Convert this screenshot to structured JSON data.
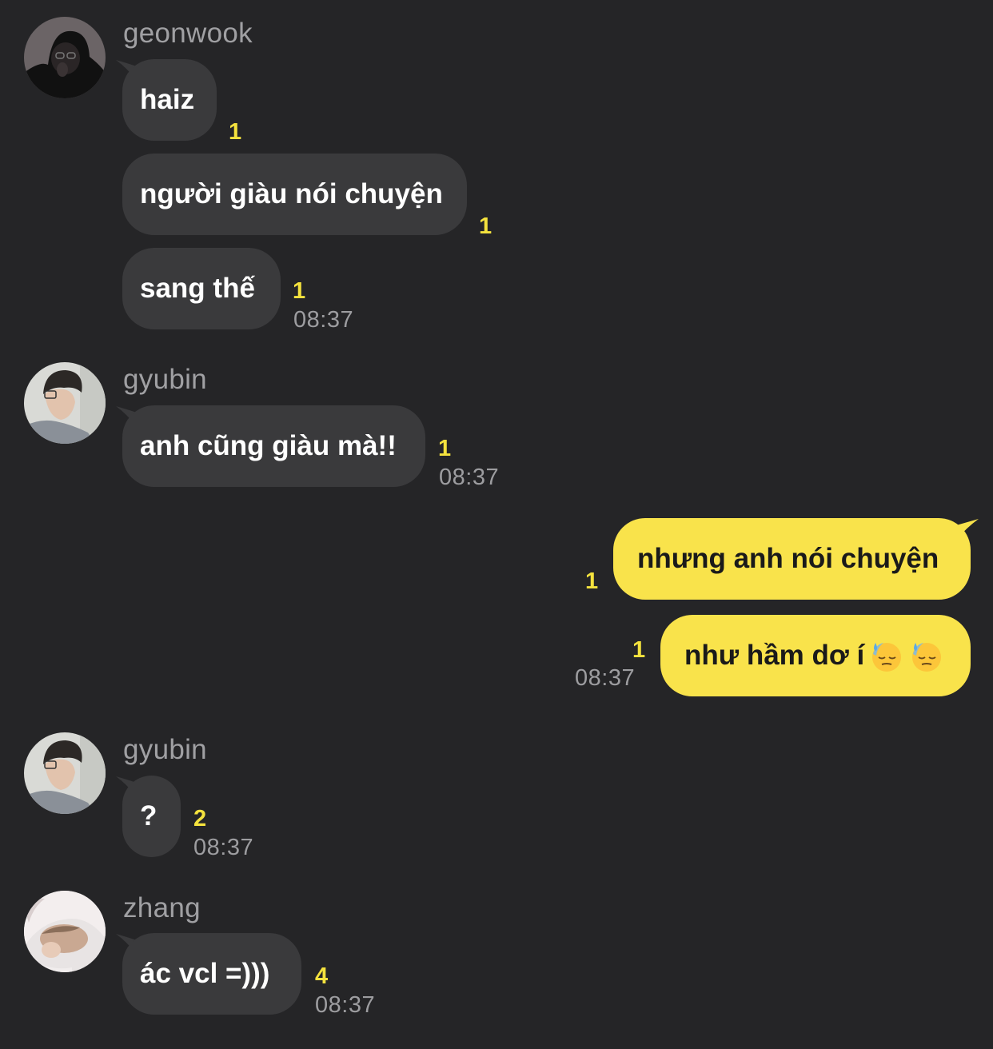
{
  "messages": {
    "g1": {
      "sender": "geonwook",
      "m1": "haiz",
      "m1_count": "1",
      "m2": "người giàu nói chuyện",
      "m2_count": "1",
      "m3": "sang thế",
      "m3_count": "1",
      "time": "08:37"
    },
    "g2": {
      "sender": "gyubin",
      "m1": "anh cũng giàu mà!!",
      "m1_count": "1",
      "time": "08:37"
    },
    "g3": {
      "m1": "nhưng anh nói chuyện",
      "m1_count": "1",
      "m2": "như hầm dơ í",
      "m2_count": "1",
      "time": "08:37"
    },
    "g4": {
      "sender": "gyubin",
      "m1": "?",
      "m1_count": "2",
      "time": "08:37"
    },
    "g5": {
      "sender": "zhang",
      "m1": "ác vcl =)))",
      "m1_count": "4",
      "time": "08:37"
    }
  },
  "colors": {
    "background": "#252527",
    "incoming_bubble": "#3a3a3c",
    "outgoing_bubble": "#f9e34b",
    "unread_count": "#f4e23e",
    "timestamp": "#9d9da0"
  },
  "icons": {
    "avatar": "avatar-photo",
    "emoji": "downcast-face-with-sweat-emoji"
  }
}
